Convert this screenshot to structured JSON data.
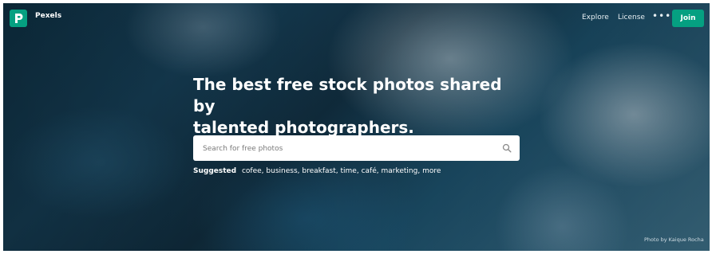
{
  "brand": {
    "name": "Pexels",
    "logo_icon": "pexels-logo-icon",
    "accent_color": "#05a081"
  },
  "nav": {
    "explore": "Explore",
    "license": "License",
    "more": "•••",
    "join": "Join"
  },
  "hero": {
    "headline_line1": "The best free stock photos shared by",
    "headline_line2": "talented photographers.",
    "photo_credit": "Photo by Kaique Rocha"
  },
  "search": {
    "placeholder": "Search for free photos",
    "value": "",
    "icon": "search-icon"
  },
  "suggested": {
    "label": "Suggested",
    "tags": [
      "cofee",
      "business",
      "breakfast",
      "time",
      "café",
      "marketing",
      "more"
    ]
  }
}
